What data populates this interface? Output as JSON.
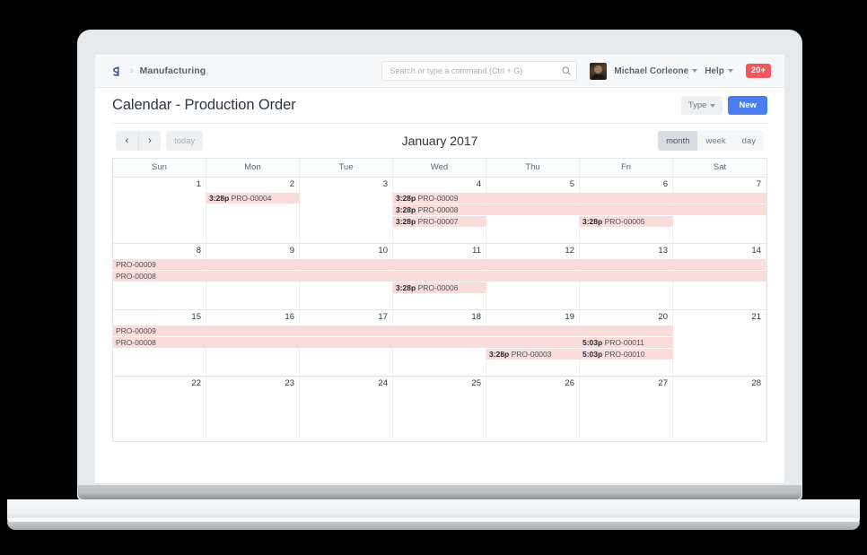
{
  "navbar": {
    "logo_icon": "brand-logo-icon",
    "breadcrumb_separator": "›",
    "breadcrumb": "Manufacturing",
    "search_placeholder": "Search or type a command (Ctrl + G)",
    "search_value": "",
    "search_icon": "search-icon",
    "user_name": "Michael Corleone",
    "help_label": "Help",
    "notification_count": "20+"
  },
  "page": {
    "title": "Calendar - Production Order",
    "type_button": "Type",
    "new_button": "New"
  },
  "calendar": {
    "prev_icon": "‹",
    "next_icon": "›",
    "today_label": "today",
    "title": "January 2017",
    "views": [
      {
        "label": "month",
        "active": true
      },
      {
        "label": "week",
        "active": false
      },
      {
        "label": "day",
        "active": false
      }
    ],
    "day_headers": [
      "Sun",
      "Mon",
      "Tue",
      "Wed",
      "Thu",
      "Fri",
      "Sat"
    ],
    "event_color": "#fadcda",
    "weeks": [
      {
        "days": [
          "1",
          "2",
          "3",
          "4",
          "5",
          "6",
          "7"
        ],
        "events": [
          {
            "start": 3,
            "span": 4,
            "row": 0,
            "time": "3:28p",
            "label": "PRO-00009"
          },
          {
            "start": 3,
            "span": 4,
            "row": 1,
            "time": "3:28p",
            "label": "PRO-00008"
          },
          {
            "start": 1,
            "span": 1,
            "row": 0,
            "time": "3:28p",
            "label": "PRO-00004"
          },
          {
            "start": 3,
            "span": 1,
            "row": 2,
            "time": "3:28p",
            "label": "PRO-00007"
          },
          {
            "start": 5,
            "span": 1,
            "row": 2,
            "time": "3:28p",
            "label": "PRO-00005"
          }
        ]
      },
      {
        "days": [
          "8",
          "9",
          "10",
          "11",
          "12",
          "13",
          "14"
        ],
        "events": [
          {
            "start": 0,
            "span": 7,
            "row": 0,
            "time": "",
            "label": "PRO-00009"
          },
          {
            "start": 0,
            "span": 7,
            "row": 1,
            "time": "",
            "label": "PRO-00008"
          },
          {
            "start": 3,
            "span": 1,
            "row": 2,
            "time": "3:28p",
            "label": "PRO-00006"
          }
        ]
      },
      {
        "days": [
          "15",
          "16",
          "17",
          "18",
          "19",
          "20",
          "21"
        ],
        "events": [
          {
            "start": 0,
            "span": 6,
            "row": 0,
            "time": "",
            "label": "PRO-00009"
          },
          {
            "start": 0,
            "span": 5,
            "row": 1,
            "time": "",
            "label": "PRO-00008"
          },
          {
            "start": 5,
            "span": 1,
            "row": 1,
            "time": "5:03p",
            "label": "PRO-00011"
          },
          {
            "start": 4,
            "span": 1,
            "row": 2,
            "time": "3:28p",
            "label": "PRO-00003"
          },
          {
            "start": 5,
            "span": 1,
            "row": 2,
            "time": "5:03p",
            "label": "PRO-00010"
          }
        ]
      },
      {
        "days": [
          "22",
          "23",
          "24",
          "25",
          "26",
          "27",
          "28"
        ],
        "events": []
      }
    ]
  }
}
